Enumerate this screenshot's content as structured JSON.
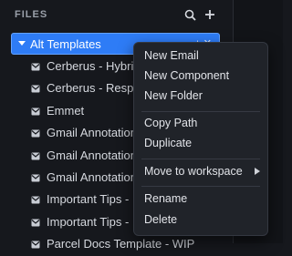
{
  "sidebar": {
    "title": "FILES",
    "icons": {
      "search": "search-icon",
      "add": "plus-icon"
    }
  },
  "folder": {
    "label": "Alt Templates",
    "caret": "caret-down-icon",
    "actions": "+  ✕"
  },
  "files": [
    {
      "label": "Cerberus - Hybrid"
    },
    {
      "label": "Cerberus - Respo"
    },
    {
      "label": "Emmet"
    },
    {
      "label": "Gmail Annotation"
    },
    {
      "label": "Gmail Annotation"
    },
    {
      "label": "Gmail Annotation"
    },
    {
      "label": "Important Tips - I"
    },
    {
      "label": "Important Tips - I"
    },
    {
      "label": "Parcel Docs Template - WIP"
    }
  ],
  "context_menu": {
    "new_email": "New Email",
    "new_component": "New Component",
    "new_folder": "New Folder",
    "copy_path": "Copy Path",
    "duplicate": "Duplicate",
    "move_to_workspace": "Move to workspace",
    "rename": "Rename",
    "delete": "Delete"
  },
  "colors": {
    "background": "#16181d",
    "selection": "#2e7cf6",
    "menu_bg": "#202329"
  }
}
